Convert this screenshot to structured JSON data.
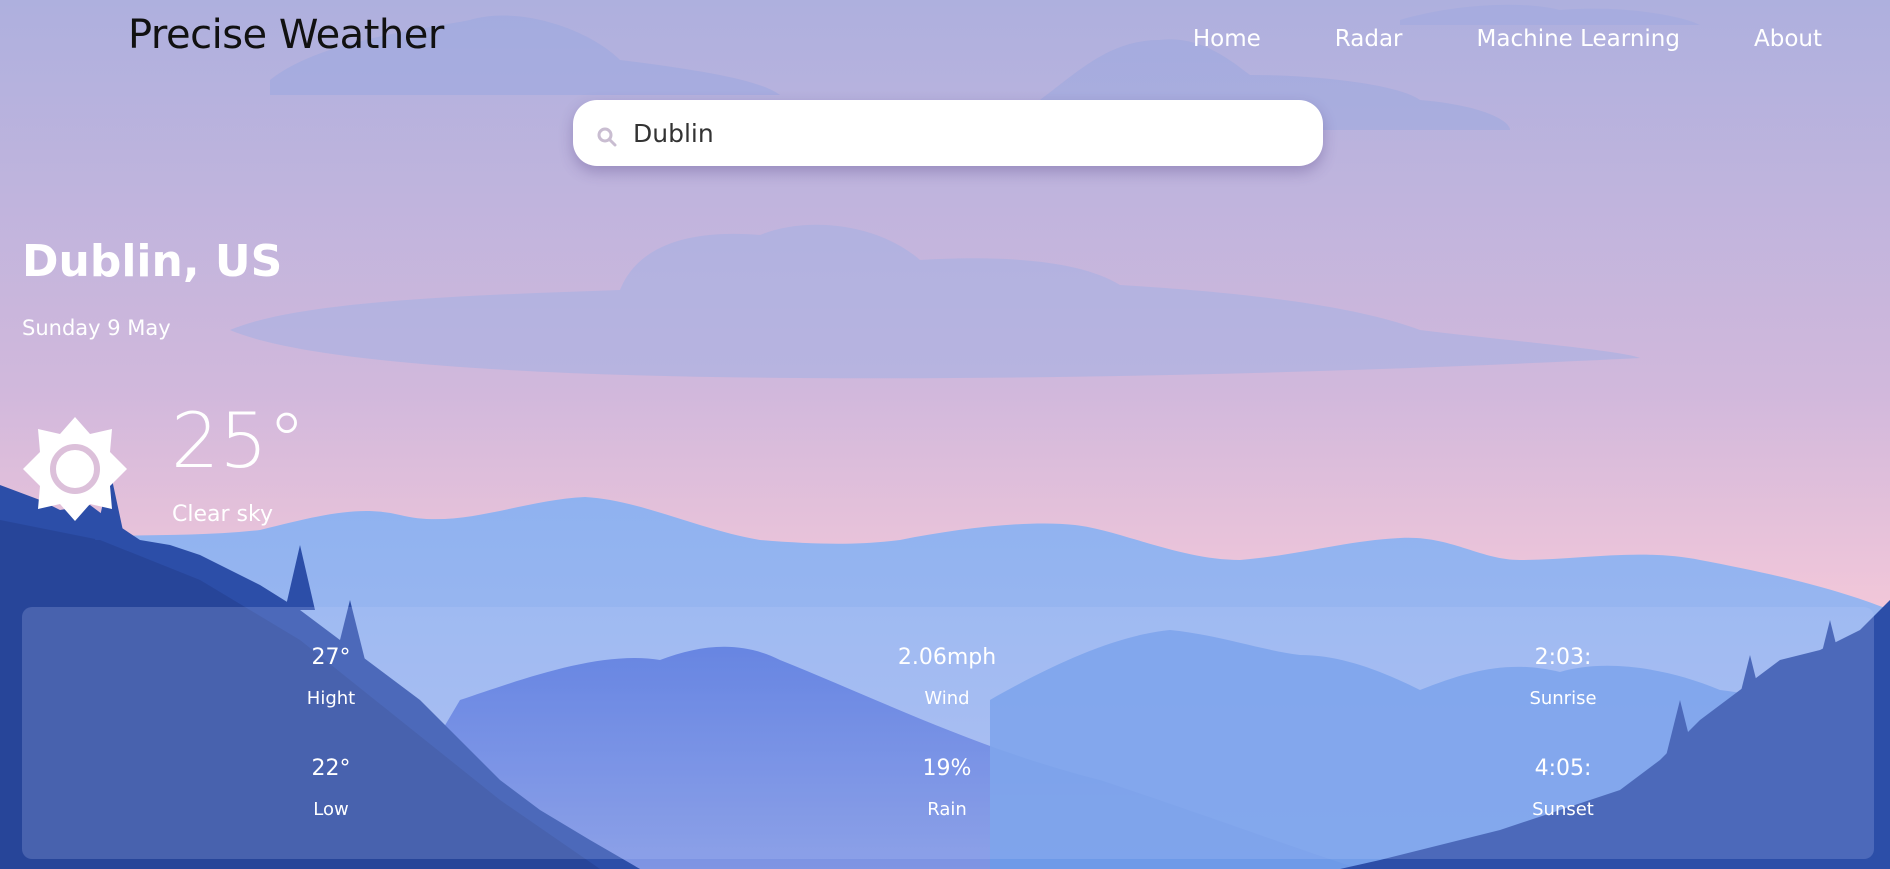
{
  "app": {
    "brand": "Precise Weather"
  },
  "nav": {
    "items": [
      {
        "label": "Home"
      },
      {
        "label": "Radar"
      },
      {
        "label": "Machine Learning"
      },
      {
        "label": "About"
      }
    ]
  },
  "search": {
    "value": "Dublin",
    "icon": "search-icon"
  },
  "location": {
    "city": "Dublin, US",
    "date": "Sunday 9 May"
  },
  "current": {
    "temperature": "25°",
    "condition": "Clear sky",
    "icon": "sun-icon"
  },
  "details": {
    "high": {
      "value": "27°",
      "label": "Hight"
    },
    "low": {
      "value": "22°",
      "label": "Low"
    },
    "wind": {
      "value": "2.06mph",
      "label": "Wind"
    },
    "rain": {
      "value": "19%",
      "label": "Rain"
    },
    "sunrise": {
      "value": "2:03:",
      "label": "Sunrise"
    },
    "sunset": {
      "value": "4:05:",
      "label": "Sunset"
    }
  },
  "colors": {
    "sky_top": "#aeb0de",
    "sky_bottom": "#f2c7d9",
    "mountain_far": "#7d9ee8",
    "mountain_mid": "#5475d8",
    "trees": "#2c4ea8",
    "panel": "#8ea7ec"
  }
}
